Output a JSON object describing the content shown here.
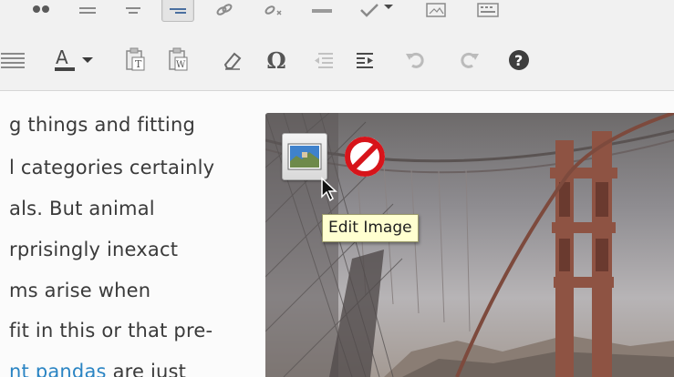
{
  "toolbar": {
    "row1": [
      {
        "name": "blockquote-button",
        "icon": "blockquote-icon"
      },
      {
        "name": "align-left-button",
        "icon": "align-left-icon"
      },
      {
        "name": "align-center-button",
        "icon": "align-center-icon"
      },
      {
        "name": "align-right-button",
        "icon": "align-right-icon",
        "active": true
      },
      {
        "name": "insert-link-button",
        "icon": "link-icon"
      },
      {
        "name": "remove-link-button",
        "icon": "unlink-icon"
      },
      {
        "name": "insert-more-button",
        "icon": "more-tag-icon"
      },
      {
        "name": "spellcheck-button",
        "icon": "spellcheck-icon"
      },
      {
        "name": "fullscreen-button",
        "icon": "fullscreen-icon"
      },
      {
        "name": "kitchen-sink-button",
        "icon": "kitchen-sink-icon"
      }
    ],
    "row2": [
      {
        "name": "justify-button",
        "icon": "justify-icon"
      },
      {
        "name": "text-color-button",
        "icon": "text-color-icon",
        "glyph": "A"
      },
      {
        "name": "paste-as-text-button",
        "icon": "paste-text-icon",
        "glyph": "T"
      },
      {
        "name": "paste-from-word-button",
        "icon": "paste-word-icon",
        "glyph": "W"
      },
      {
        "name": "clear-formatting-button",
        "icon": "eraser-icon"
      },
      {
        "name": "special-character-button",
        "icon": "omega-icon",
        "glyph": "Ω"
      },
      {
        "name": "outdent-button",
        "icon": "outdent-icon"
      },
      {
        "name": "indent-button",
        "icon": "indent-icon"
      },
      {
        "name": "undo-button",
        "icon": "undo-icon"
      },
      {
        "name": "redo-button",
        "icon": "redo-icon"
      },
      {
        "name": "help-button",
        "icon": "help-icon",
        "glyph": "?"
      }
    ],
    "colors": {
      "icon": "#7a7a7a",
      "icon_dark": "#555555",
      "text_color_bar": "#444444"
    }
  },
  "content": {
    "lines": [
      {
        "text": "g things and fitting"
      },
      {
        "text": "l categories certainly"
      },
      {
        "text": "als. But animal"
      },
      {
        "text": "rprisingly inexact"
      },
      {
        "text": "ms arise when"
      },
      {
        "text": "fit in this or that pre-"
      },
      {
        "text": "are just",
        "link": "nt pandas"
      }
    ],
    "link_color": "#2a84c3"
  },
  "image": {
    "subject": "golden-gate-bridge",
    "edit_button": {
      "icon": "edit-image-icon"
    },
    "delete_button": {
      "icon": "delete-image-icon",
      "color": "#d7141a"
    },
    "tooltip": "Edit Image"
  }
}
